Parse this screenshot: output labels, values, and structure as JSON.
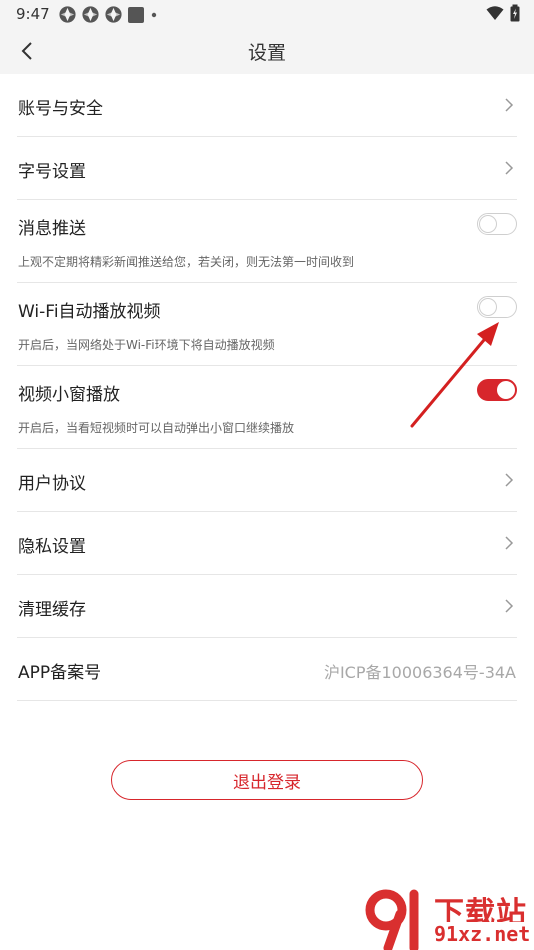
{
  "status_bar": {
    "time": "9:47"
  },
  "header": {
    "title": "设置"
  },
  "settings": {
    "account_security": "账号与安全",
    "font_size": "字号设置",
    "push": {
      "label": "消息推送",
      "desc": "上观不定期将精彩新闻推送给您，若关闭，则无法第一时间收到",
      "enabled": false
    },
    "wifi_autoplay": {
      "label": "Wi-Fi自动播放视频",
      "desc": "开启后，当网络处于Wi-Fi环境下将自动播放视频",
      "enabled": false
    },
    "mini_window": {
      "label": "视频小窗播放",
      "desc": "开启后，当看短视频时可以自动弹出小窗口继续播放",
      "enabled": true
    },
    "user_agreement": "用户协议",
    "privacy": "隐私设置",
    "clear_cache": "清理缓存",
    "icp": {
      "label": "APP备案号",
      "value": "沪ICP备10006364号-34A"
    }
  },
  "logout_label": "退出登录",
  "watermark": {
    "top": "下载站",
    "bottom": "91xz.net"
  },
  "colors": {
    "accent": "#d7262c",
    "annotation_arrow": "#d42020"
  }
}
